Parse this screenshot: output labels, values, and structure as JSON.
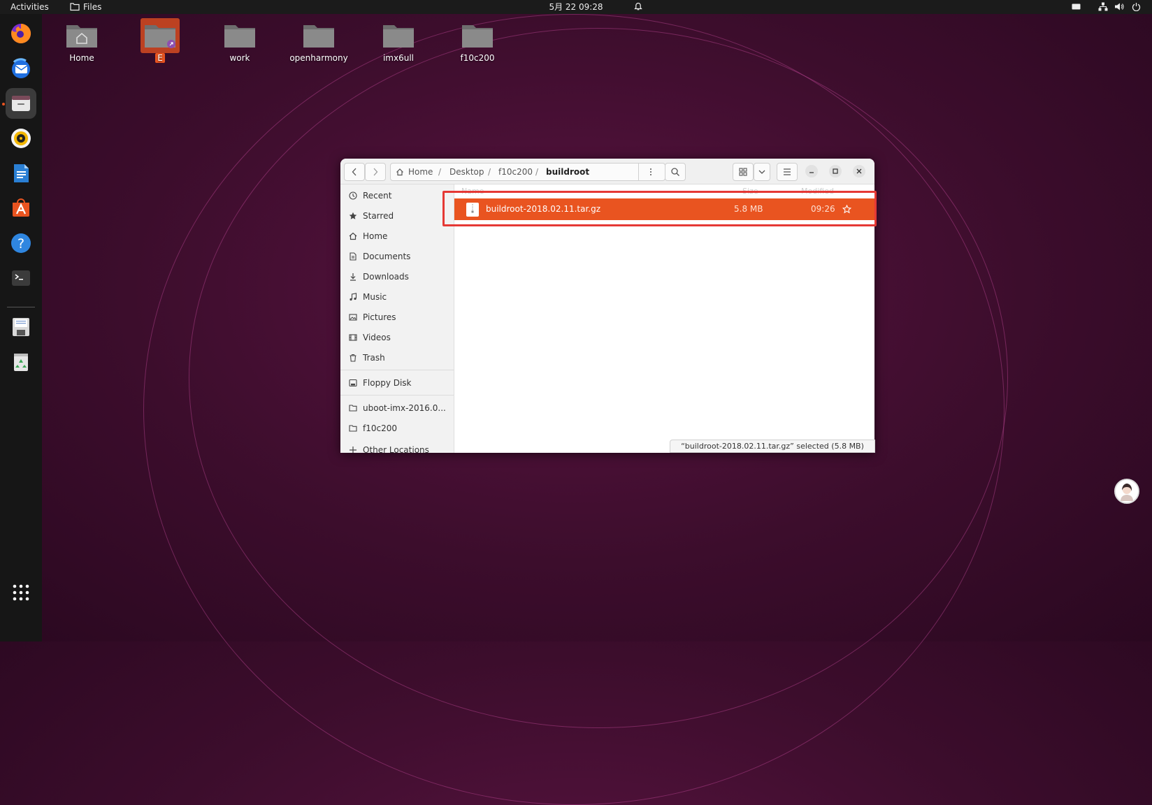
{
  "topbar": {
    "activities": "Activities",
    "app_name": "Files",
    "clock": "5月 22  09:28"
  },
  "desktop": {
    "icons": [
      {
        "label": "Home",
        "icon": "home-folder-icon"
      },
      {
        "label": "E",
        "icon": "folder-link-icon",
        "selected": true
      },
      {
        "label": "work",
        "icon": "folder-icon"
      },
      {
        "label": "openharmony",
        "icon": "folder-icon"
      },
      {
        "label": "imx6ull",
        "icon": "folder-icon"
      },
      {
        "label": "f10c200",
        "icon": "folder-icon"
      }
    ]
  },
  "dock": {
    "apps": [
      "firefox-icon",
      "thunderbird-icon",
      "files-icon",
      "rhythmbox-icon",
      "libreoffice-writer-icon",
      "ubuntu-software-icon",
      "help-icon",
      "terminal-icon",
      "floppy-disk-icon",
      "trash-icon",
      "show-apps-icon"
    ]
  },
  "window": {
    "path": [
      "Home",
      "Desktop",
      "f10c200",
      "buildroot"
    ],
    "sidebar": [
      {
        "label": "Recent",
        "icon": "clock-icon"
      },
      {
        "label": "Starred",
        "icon": "star-icon"
      },
      {
        "label": "Home",
        "icon": "home-icon"
      },
      {
        "label": "Documents",
        "icon": "document-icon"
      },
      {
        "label": "Downloads",
        "icon": "download-icon"
      },
      {
        "label": "Music",
        "icon": "music-icon"
      },
      {
        "label": "Pictures",
        "icon": "picture-icon"
      },
      {
        "label": "Videos",
        "icon": "video-icon"
      },
      {
        "label": "Trash",
        "icon": "trash-icon"
      },
      {
        "label": "Floppy Disk",
        "icon": "drive-icon"
      },
      {
        "label": "uboot-imx-2016.0...",
        "icon": "folder-icon"
      },
      {
        "label": "f10c200",
        "icon": "folder-icon"
      },
      {
        "label": "Other Locations",
        "icon": "plus-icon"
      }
    ],
    "columns": {
      "name": "Name",
      "size": "Size",
      "modified": "Modified"
    },
    "files": [
      {
        "name": "buildroot-2018.02.11.tar.gz",
        "size": "5.8 MB",
        "modified": "09:26",
        "selected": true
      }
    ],
    "status": "“buildroot-2018.02.11.tar.gz” selected  (5.8 MB)"
  },
  "colors": {
    "accent": "#e95420",
    "highlight_box": "#e53935"
  }
}
